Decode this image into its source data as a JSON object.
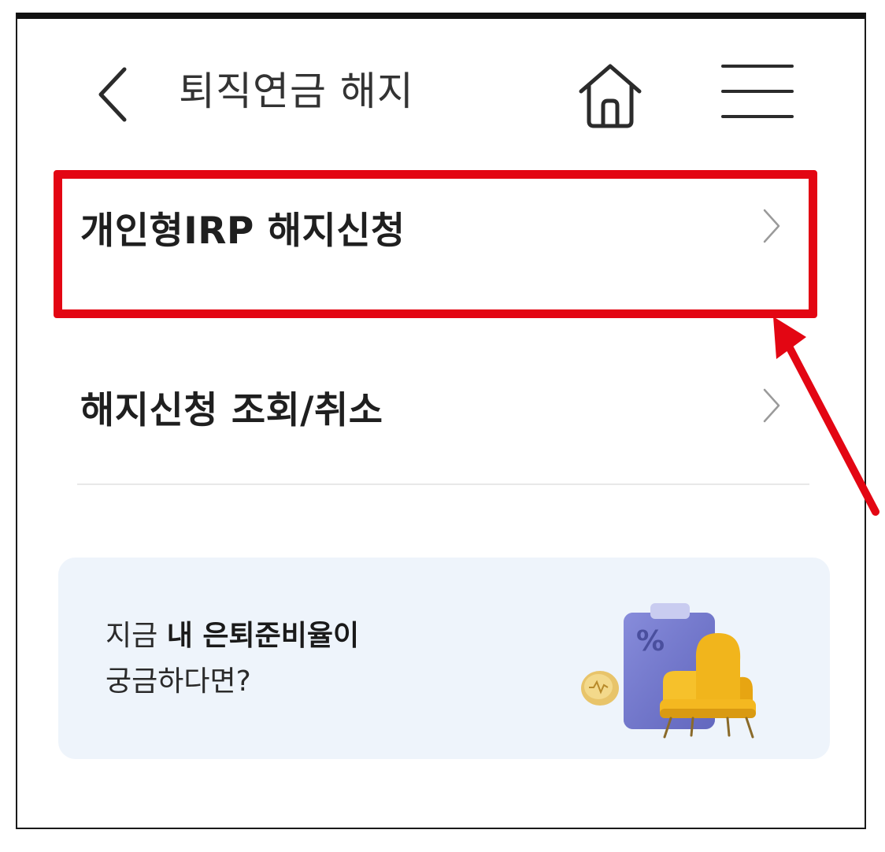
{
  "header": {
    "title": "퇴직연금 해지",
    "back_icon": "chevron-left-icon",
    "home_icon": "home-icon",
    "menu_icon": "hamburger-menu-icon"
  },
  "menu": {
    "items": [
      {
        "label": "개인형IRP 해지신청",
        "icon": "chevron-right-icon",
        "highlighted": true
      },
      {
        "label": "해지신청 조회/취소",
        "icon": "chevron-right-icon",
        "highlighted": false
      }
    ]
  },
  "promo": {
    "line1_prefix": "지금 ",
    "line1_strong": "내 은퇴준비율이",
    "line2": "궁금하다면?",
    "illustration": "retirement-chair-illustration",
    "percent_symbol": "%"
  },
  "annotation": {
    "highlight_color": "#e30613",
    "arrow_color": "#e30613"
  }
}
